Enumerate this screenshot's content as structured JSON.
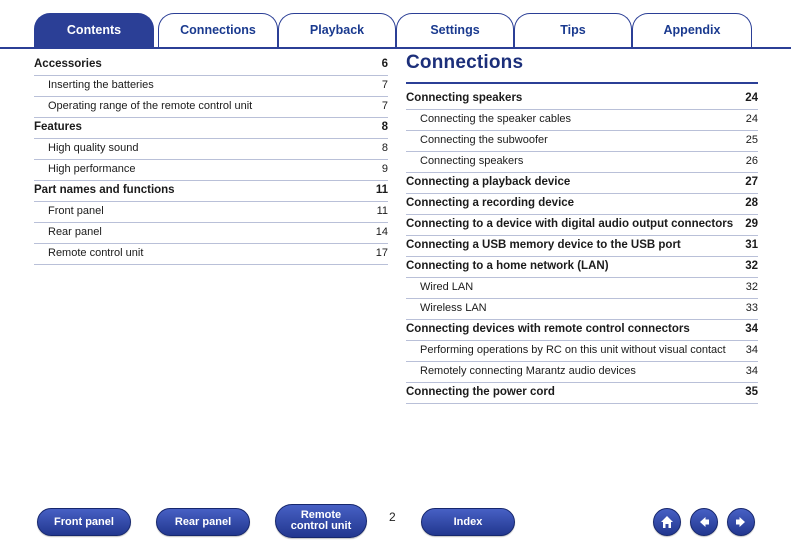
{
  "tabs": [
    {
      "label": "Contents",
      "active": true
    },
    {
      "label": "Connections",
      "active": false
    },
    {
      "label": "Playback",
      "active": false
    },
    {
      "label": "Settings",
      "active": false
    },
    {
      "label": "Tips",
      "active": false
    },
    {
      "label": "Appendix",
      "active": false
    }
  ],
  "left_column": {
    "entries": [
      {
        "label": "Accessories",
        "page": "6",
        "level": 1
      },
      {
        "label": "Inserting the batteries",
        "page": "7",
        "level": 2
      },
      {
        "label": "Operating range of the remote control unit",
        "page": "7",
        "level": 2
      },
      {
        "label": "Features",
        "page": "8",
        "level": 1
      },
      {
        "label": "High quality sound",
        "page": "8",
        "level": 2
      },
      {
        "label": "High performance",
        "page": "9",
        "level": 2
      },
      {
        "label": "Part names and functions",
        "page": "11",
        "level": 1
      },
      {
        "label": "Front panel",
        "page": "11",
        "level": 2
      },
      {
        "label": "Rear panel",
        "page": "14",
        "level": 2
      },
      {
        "label": "Remote control unit",
        "page": "17",
        "level": 2
      }
    ]
  },
  "right_column": {
    "title": "Connections",
    "entries": [
      {
        "label": "Connecting speakers",
        "page": "24",
        "level": 1
      },
      {
        "label": "Connecting the speaker cables",
        "page": "24",
        "level": 2
      },
      {
        "label": "Connecting the subwoofer",
        "page": "25",
        "level": 2
      },
      {
        "label": "Connecting speakers",
        "page": "26",
        "level": 2
      },
      {
        "label": "Connecting a playback device",
        "page": "27",
        "level": 1
      },
      {
        "label": "Connecting a recording device",
        "page": "28",
        "level": 1
      },
      {
        "label": "Connecting to a device with digital audio output connectors",
        "page": "29",
        "level": 1
      },
      {
        "label": "Connecting a USB memory device to the USB port",
        "page": "31",
        "level": 1
      },
      {
        "label": "Connecting to a home network (LAN)",
        "page": "32",
        "level": 1
      },
      {
        "label": "Wired LAN",
        "page": "32",
        "level": 2
      },
      {
        "label": "Wireless LAN",
        "page": "33",
        "level": 2
      },
      {
        "label": "Connecting devices with remote control connectors",
        "page": "34",
        "level": 1
      },
      {
        "label": "Performing operations by RC on this unit without visual contact",
        "page": "34",
        "level": 2
      },
      {
        "label": "Remotely connecting Marantz audio devices",
        "page": "34",
        "level": 2
      },
      {
        "label": "Connecting the power cord",
        "page": "35",
        "level": 1
      }
    ]
  },
  "footer": {
    "buttons": [
      {
        "label": "Front panel"
      },
      {
        "label": "Rear panel"
      },
      {
        "label": "Remote control unit"
      },
      {
        "label": "Index"
      }
    ],
    "page_number": "2",
    "nav_icons": [
      {
        "name": "home-icon"
      },
      {
        "name": "previous-page-icon"
      },
      {
        "name": "next-page-icon"
      }
    ]
  },
  "colors": {
    "accent": "#2b3f96",
    "title": "#1c2f7a",
    "button": "#2f4bb0"
  }
}
